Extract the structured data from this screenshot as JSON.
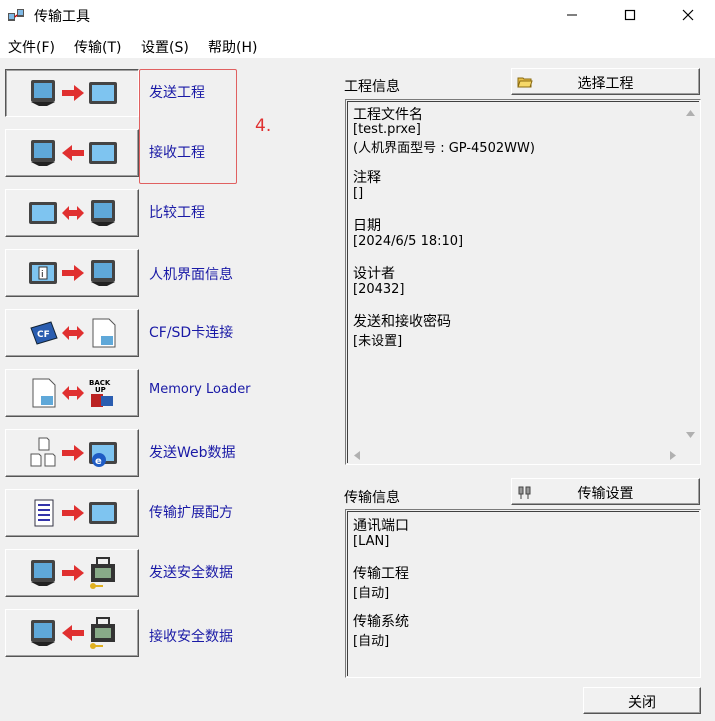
{
  "window": {
    "title": "传输工具",
    "icons": {
      "app": "transfer-tool-icon",
      "minimize": "minimize-icon",
      "maximize": "maximize-icon",
      "close": "close-icon"
    }
  },
  "menu": [
    "文件(F)",
    "传输(T)",
    "设置(S)",
    "帮助(H)"
  ],
  "tools": [
    {
      "label": "发送工程",
      "icon": "send-project-icon"
    },
    {
      "label": "接收工程",
      "icon": "receive-project-icon"
    },
    {
      "label": "比较工程",
      "icon": "compare-project-icon"
    },
    {
      "label": "人机界面信息",
      "icon": "hmi-info-icon"
    },
    {
      "label": "CF/SD卡连接",
      "icon": "cf-sd-card-connect-icon"
    },
    {
      "label": "Memory Loader",
      "icon": "memory-loader-icon"
    },
    {
      "label": "发送Web数据",
      "icon": "send-web-data-icon"
    },
    {
      "label": "传输扩展配方",
      "icon": "transfer-recipe-icon"
    },
    {
      "label": "发送安全数据",
      "icon": "send-security-data-icon"
    },
    {
      "label": "接收安全数据",
      "icon": "receive-security-data-icon"
    }
  ],
  "annotation": "4.",
  "project_info": {
    "label": "工程信息",
    "select_button": "选择工程",
    "select_icon": "folder-icon",
    "lines": [
      {
        "text": "工程文件名",
        "heading": true
      },
      {
        "text": "[test.prxe]",
        "heading": false
      },
      {
        "text": "(人机界面型号 : GP-4502WW)",
        "heading": false
      },
      {
        "text": "",
        "heading": false
      },
      {
        "text": "注释",
        "heading": true
      },
      {
        "text": "[]",
        "heading": false
      },
      {
        "text": "",
        "heading": false
      },
      {
        "text": "日期",
        "heading": true
      },
      {
        "text": "[2024/6/5 18:10]",
        "heading": false
      },
      {
        "text": "",
        "heading": false
      },
      {
        "text": "设计者",
        "heading": true
      },
      {
        "text": "[20432]",
        "heading": false
      },
      {
        "text": "",
        "heading": false
      },
      {
        "text": "发送和接收密码",
        "heading": true
      },
      {
        "text": "[未设置]",
        "heading": false
      }
    ]
  },
  "transfer_info": {
    "label": "传输信息",
    "settings_button": "传输设置",
    "settings_icon": "cable-icon",
    "lines": [
      {
        "text": "通讯端口",
        "heading": true
      },
      {
        "text": "[LAN]",
        "heading": false
      },
      {
        "text": "",
        "heading": false
      },
      {
        "text": "传输工程",
        "heading": true
      },
      {
        "text": "[自动]",
        "heading": false
      },
      {
        "text": "",
        "heading": false
      },
      {
        "text": "传输系统",
        "heading": true
      },
      {
        "text": "[自动]",
        "heading": false
      }
    ]
  },
  "close_button": "关闭"
}
